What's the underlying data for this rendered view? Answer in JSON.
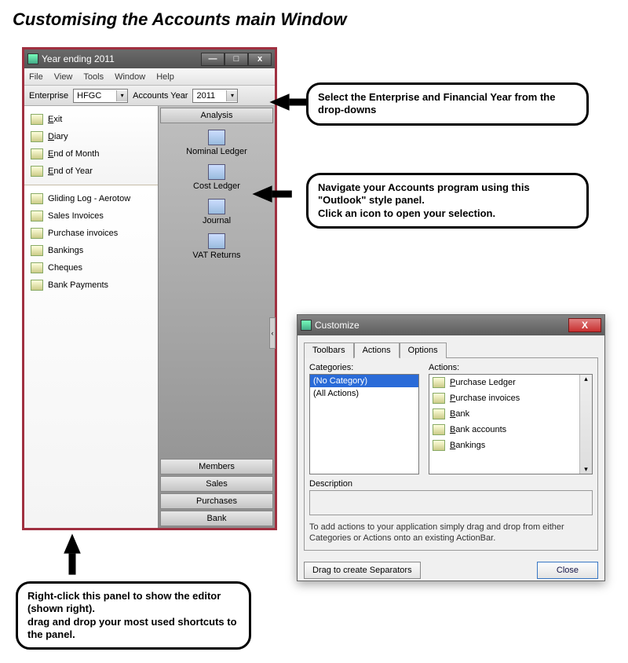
{
  "page": {
    "title": "Customising the Accounts main Window"
  },
  "main_window": {
    "title": "Year ending 2011",
    "menus": [
      "File",
      "View",
      "Tools",
      "Window",
      "Help"
    ],
    "toolbar": {
      "enterprise_label": "Enterprise",
      "enterprise_value": "HFGC",
      "year_label": "Accounts Year",
      "year_value": "2011"
    },
    "sidebar_upper": [
      {
        "mnemonic": "E",
        "rest": "xit"
      },
      {
        "mnemonic": "D",
        "rest": "iary"
      },
      {
        "mnemonic": "E",
        "rest": "nd of Month"
      },
      {
        "mnemonic": "E",
        "rest": "nd of Year"
      }
    ],
    "sidebar_lower": [
      "Gliding Log - Aerotow",
      "Sales Invoices",
      "Purchase invoices",
      "Bankings",
      "Cheques",
      "Bank Payments"
    ],
    "nav": {
      "section": "Analysis",
      "items": [
        "Nominal Ledger",
        "Cost Ledger",
        "Journal",
        "VAT Returns"
      ],
      "buttons": [
        "Members",
        "Sales",
        "Purchases",
        "Bank"
      ]
    }
  },
  "customize_dialog": {
    "title": "Customize",
    "tabs": [
      "Toolbars",
      "Actions",
      "Options"
    ],
    "active_tab": "Actions",
    "categories_label": "Categories:",
    "categories": [
      "(No Category)",
      "(All Actions)"
    ],
    "selected_category": "(No Category)",
    "actions_label": "Actions:",
    "actions": [
      "Purchase Ledger",
      "Purchase invoices",
      "Bank",
      "Bank accounts",
      "Bankings"
    ],
    "description_label": "Description",
    "hint": "To add actions to your application simply drag and drop from either Categories or Actions onto an existing ActionBar.",
    "drag_sep": "Drag to create Separators",
    "close": "Close"
  },
  "callouts": {
    "c1": "Select the Enterprise and Financial Year from the drop-downs",
    "c2": "Navigate your Accounts program using this \"Outlook\" style panel.\nClick an icon to open your selection.",
    "c3": "Right-click this panel to show the editor (shown right).\ndrag and drop your most used shortcuts to the panel."
  }
}
